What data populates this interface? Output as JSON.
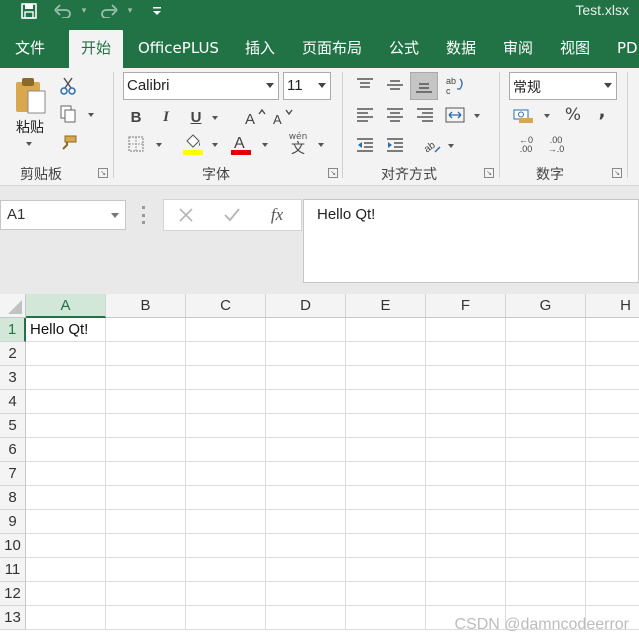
{
  "window": {
    "title": "Test.xlsx"
  },
  "tabs": [
    "文件",
    "开始",
    "OfficePLUS",
    "插入",
    "页面布局",
    "公式",
    "数据",
    "审阅",
    "视图",
    "PDF"
  ],
  "active_tab": "开始",
  "ribbon": {
    "clipboard": {
      "paste_label": "粘贴",
      "group_label": "剪贴板"
    },
    "font": {
      "name": "Calibri",
      "size": "11",
      "group_label": "字体",
      "bold": "B",
      "italic": "I",
      "underline": "U",
      "font_color_letter": "A",
      "phonetic": "wén",
      "phonetic_char": "文"
    },
    "alignment": {
      "group_label": "对齐方式"
    },
    "number": {
      "format": "常规",
      "group_label": "数字",
      "percent": "%",
      "comma": ",",
      "inc_decimal_top": "←0",
      "inc_decimal_bottom": ".00",
      "dec_decimal_top": ".00",
      "dec_decimal_bottom": "→.0"
    }
  },
  "formula_bar": {
    "name_box": "A1",
    "content": "Hello Qt!",
    "fx": "fx"
  },
  "sheet": {
    "columns": [
      "A",
      "B",
      "C",
      "D",
      "E",
      "F",
      "G",
      "H"
    ],
    "rows": [
      "1",
      "2",
      "3",
      "4",
      "5",
      "6",
      "7",
      "8",
      "9",
      "10",
      "11",
      "12",
      "13"
    ],
    "cells": {
      "A1": "Hello Qt!"
    },
    "selected_cell": "A1"
  },
  "watermark": "CSDN @damncodeerror",
  "colors": {
    "accent": "#217346",
    "ribbon_bg": "#f3f3f3"
  }
}
